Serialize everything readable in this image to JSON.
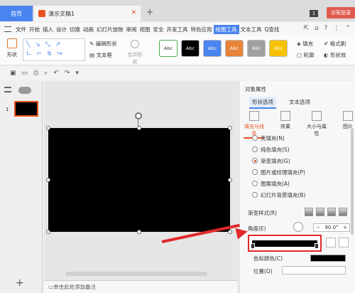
{
  "titlebar": {
    "home_tab": "首页",
    "doc_tab": "演示文稿1",
    "window_count": "1",
    "guest_button": "访客登录"
  },
  "menu": {
    "items": [
      "文件",
      "开始",
      "插入",
      "设计",
      "切换",
      "动画",
      "幻灯片放映",
      "审阅",
      "视图",
      "安全",
      "开发工具",
      "特色应用",
      "绘图工具",
      "文本工具"
    ],
    "active": "绘图工具",
    "search": "Q查找"
  },
  "ribbon": {
    "shape_label": "形状",
    "edit_shape": "编辑形状",
    "textbox": "文本框",
    "merge_shape": "合并形状",
    "style_label": "Abc",
    "fill": "填充",
    "outline": "轮廓",
    "format_painter": "格式刷",
    "shape_effect": "形状效"
  },
  "styles": [
    {
      "bg": "#ffffff",
      "fg": "#333333"
    },
    {
      "bg": "#000000",
      "fg": "#ffffff"
    },
    {
      "bg": "#4a84ef",
      "fg": "#ffffff"
    },
    {
      "bg": "#e8843a",
      "fg": "#ffffff"
    },
    {
      "bg": "#a0a0a0",
      "fg": "#ffffff"
    },
    {
      "bg": "#f6c200",
      "fg": "#ffffff"
    }
  ],
  "slides": {
    "thumb_number": "1"
  },
  "notes": {
    "placeholder": "单击此处添加备注"
  },
  "properties": {
    "title": "对象属性",
    "tab_shape": "形状选项",
    "tab_text": "文本选项",
    "cat_fill_line": "填充与线条",
    "cat_effect": "效果",
    "cat_size": "大小与属性",
    "cat_picture": "图片",
    "options": [
      "无填充(N)",
      "纯色填充(S)",
      "渐变填充(G)",
      "图片或纹理填充(P)",
      "图案填充(A)",
      "幻灯片背景填充(B)"
    ],
    "selected_option": "渐变填充(G)",
    "gradient_style_label": "渐变样式(R)",
    "angle_label": "角度(E)",
    "angle_value": "90.0°",
    "color_label": "色标颜色(C)",
    "position_label": "位置(O)"
  },
  "colors": {
    "accent": "#4a84ef",
    "highlight": "#e0292b",
    "active_tab": "#e8531f"
  }
}
